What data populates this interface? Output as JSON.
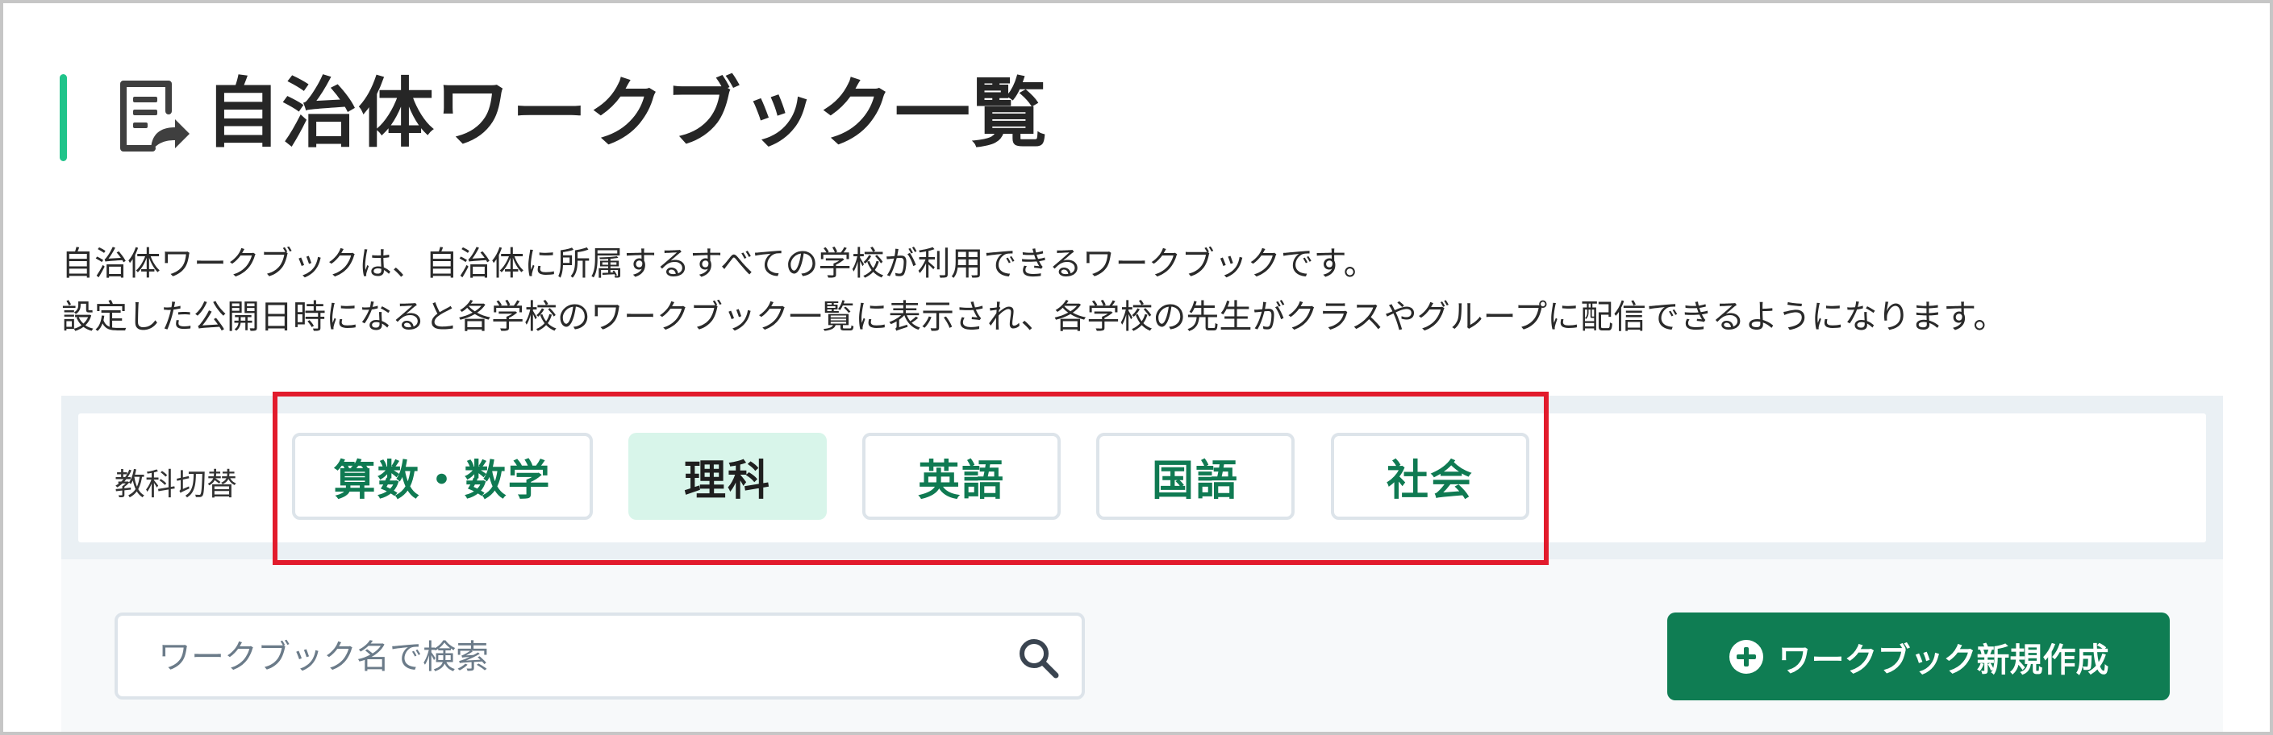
{
  "header": {
    "title": "自治体ワークブック一覧",
    "icon": "workbook-share-icon",
    "accent_color": "#20c48a"
  },
  "description": {
    "line1": "自治体ワークブックは、自治体に所属するすべての学校が利用できるワークブックです。",
    "line2": "設定した公開日時になると各学校のワークブック一覧に表示され、各学校の先生がクラスやグループに配信できるようになります。"
  },
  "subject_switch": {
    "label": "教科切替",
    "options": [
      "算数・数学",
      "理科",
      "英語",
      "国語",
      "社会"
    ],
    "selected": "理科",
    "highlight_color": "#e21b2c"
  },
  "search": {
    "placeholder": "ワークブック名で検索",
    "value": "",
    "icon": "search-icon"
  },
  "create_button": {
    "label": "ワークブック新規作成",
    "icon": "plus-circle-icon",
    "color": "#0f7d53"
  }
}
